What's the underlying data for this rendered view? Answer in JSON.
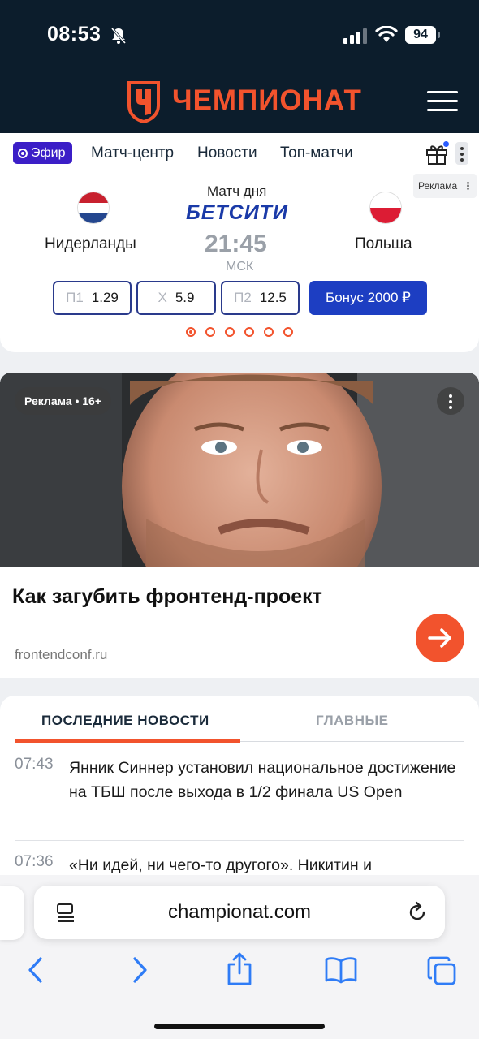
{
  "status": {
    "time": "08:53",
    "battery": "94"
  },
  "header": {
    "brand": "ЧЕМПИОНАТ"
  },
  "nav": {
    "live": "Эфир",
    "links": [
      "Матч-центр",
      "Новости",
      "Топ-матчи"
    ]
  },
  "match": {
    "ad_tag": "Реклама",
    "label": "Матч дня",
    "sponsor": "БЕТСИТИ",
    "home": "Нидерланды",
    "away": "Польша",
    "time": "21:45",
    "tz": "МСК",
    "odds": [
      {
        "key": "П1",
        "value": "1.29"
      },
      {
        "key": "Х",
        "value": "5.9"
      },
      {
        "key": "П2",
        "value": "12.5"
      }
    ],
    "bonus": "Бонус 2000 ₽",
    "colors": {
      "accent": "#f2532d",
      "bonus": "#1d3ec2"
    }
  },
  "ad": {
    "label": "Реклама • 16+",
    "title": "Как загубить фронтенд-проект",
    "domain": "frontendconf.ru"
  },
  "news": {
    "tabs": [
      "ПОСЛЕДНИЕ НОВОСТИ",
      "ГЛАВНЫЕ"
    ],
    "items": [
      {
        "time": "07:43",
        "text": "Янник Синнер установил национальное достижение на ТБШ после выхода в 1/2 финала US Open"
      },
      {
        "time": "07:36",
        "text": "«Ни идей, ни чего-то другого». Никитин и"
      }
    ]
  },
  "browser": {
    "url": "championat.com"
  }
}
